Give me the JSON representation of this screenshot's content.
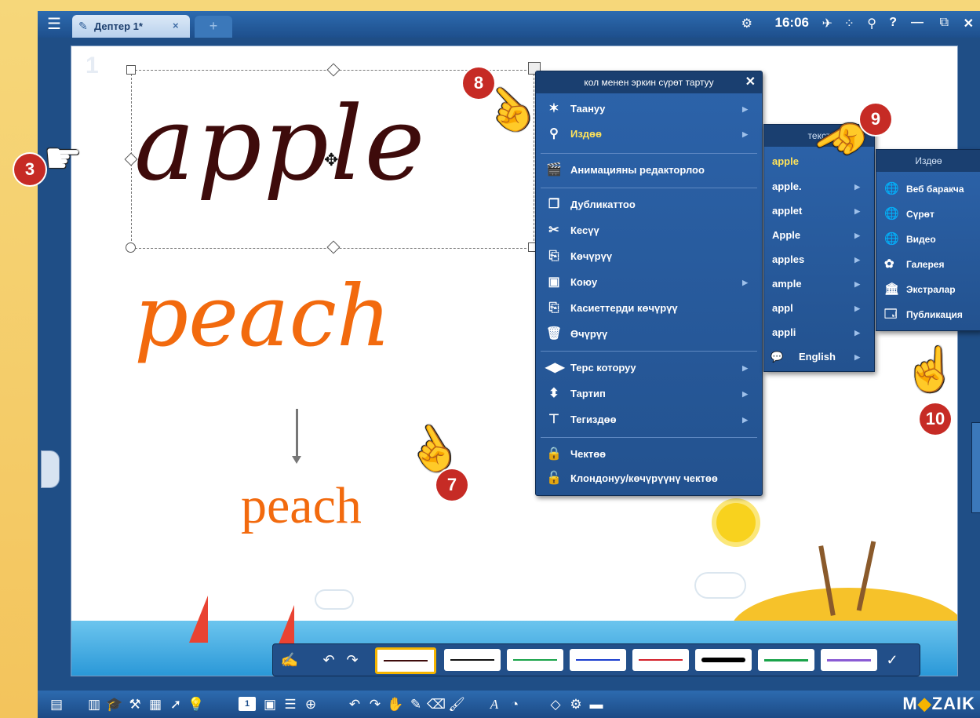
{
  "titlebar": {
    "tab_title": "Дептер 1*",
    "tab_close": "×",
    "new_tab": "+",
    "clock": "16:06",
    "icons": [
      "settings-icon",
      "rocket-icon",
      "grid-icon",
      "search-icon",
      "help-icon",
      "minimize-icon",
      "restore-icon",
      "close-icon"
    ]
  },
  "canvas": {
    "page_number": "1",
    "word_apple": "apple",
    "word_peach_handwritten": "peach",
    "word_peach_typed": "peach"
  },
  "context_menu": {
    "title": "кол менен эркин сүрөт тартуу",
    "close": "✕",
    "items": [
      {
        "label": "Таануу",
        "icon": "recognize-icon",
        "submenu": true
      },
      {
        "label": "Издөө",
        "icon": "search-icon",
        "submenu": true,
        "active": true
      },
      {
        "label": "Анимацияны редакторлоо",
        "icon": "animation-icon",
        "submenu": false
      },
      {
        "label": "Дубликаттоо",
        "icon": "duplicate-icon",
        "submenu": false
      },
      {
        "label": "Кесүү",
        "icon": "scissors-icon",
        "submenu": false
      },
      {
        "label": "Көчүрүү",
        "icon": "copy-icon",
        "submenu": false
      },
      {
        "label": "Коюу",
        "icon": "paste-icon",
        "submenu": true
      },
      {
        "label": "Касиеттерди көчүрүү",
        "icon": "copy-properties-icon",
        "submenu": false
      },
      {
        "label": "Өчүрүү",
        "icon": "trash-icon",
        "submenu": false
      },
      {
        "label": "Терс которуу",
        "icon": "flip-icon",
        "submenu": true
      },
      {
        "label": "Тартип",
        "icon": "order-icon",
        "submenu": true
      },
      {
        "label": "Тегиздөө",
        "icon": "align-icon",
        "submenu": true
      },
      {
        "label": "Чектөө",
        "icon": "lock-icon",
        "submenu": false
      },
      {
        "label": "Клондонуу/көчүрүүнү чектөө",
        "icon": "lock-clone-icon",
        "submenu": false
      }
    ]
  },
  "text_submenu": {
    "title": "текст",
    "items": [
      {
        "label": "apple",
        "active": true
      },
      {
        "label": "apple."
      },
      {
        "label": "applet"
      },
      {
        "label": "Apple"
      },
      {
        "label": "apples"
      },
      {
        "label": "ample"
      },
      {
        "label": "appl"
      },
      {
        "label": "appli"
      },
      {
        "label": "English",
        "icon": "language-icon"
      }
    ]
  },
  "search_submenu": {
    "title": "Издөө",
    "items": [
      {
        "label": "Веб баракча",
        "icon": "globe-icon"
      },
      {
        "label": "Сүрөт",
        "icon": "globe-icon"
      },
      {
        "label": "Видео",
        "icon": "globe-icon"
      },
      {
        "label": "Галерея",
        "icon": "gallery-icon"
      },
      {
        "label": "Экстралар",
        "icon": "extras-icon"
      },
      {
        "label": "Публикация",
        "icon": "publication-icon"
      }
    ]
  },
  "callouts": [
    "3",
    "7",
    "8",
    "9",
    "10"
  ],
  "bottombar": {
    "page_box": "1",
    "logo_left": "M",
    "logo_dot": "◆",
    "logo_right": "ZAIK"
  },
  "colors": {
    "apple_ink": "#3e0b0b",
    "peach_ink": "#f26a0e",
    "menu_bg": "#2c63aa",
    "highlight_text": "#ffe35a",
    "callout_red": "#c62b25"
  }
}
